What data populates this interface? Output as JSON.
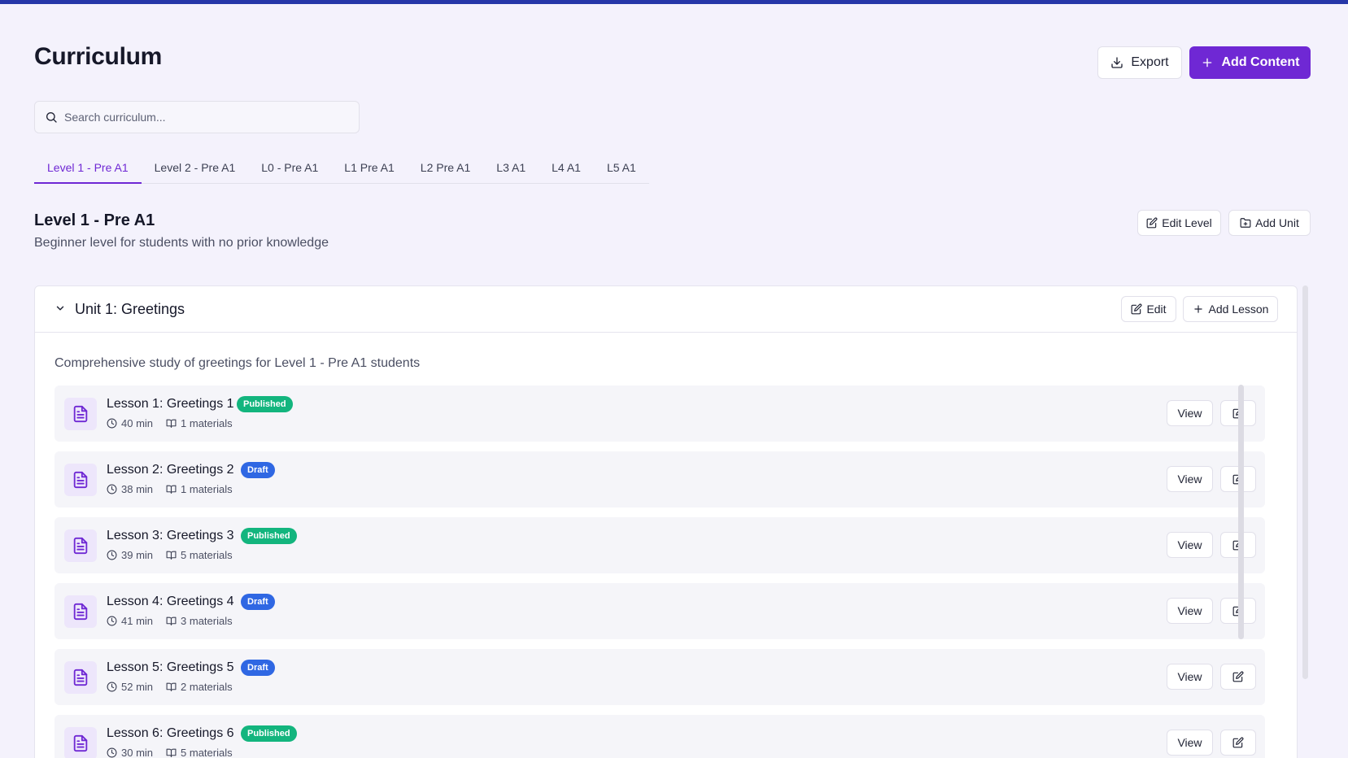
{
  "page": {
    "title": "Curriculum",
    "export_label": "Export",
    "add_content_label": "Add Content",
    "search_placeholder": "Search curriculum..."
  },
  "tabs": [
    {
      "label": "Level 1 - Pre A1",
      "active": true
    },
    {
      "label": "Level 2 - Pre A1",
      "active": false
    },
    {
      "label": "L0 - Pre A1",
      "active": false
    },
    {
      "label": "L1 Pre A1",
      "active": false
    },
    {
      "label": "L2 Pre A1",
      "active": false
    },
    {
      "label": "L3 A1",
      "active": false
    },
    {
      "label": "L4 A1",
      "active": false
    },
    {
      "label": "L5 A1",
      "active": false
    }
  ],
  "level": {
    "title": "Level 1 - Pre A1",
    "description": "Beginner level for students with no prior knowledge",
    "edit_level_label": "Edit Level",
    "add_unit_label": "Add Unit"
  },
  "unit": {
    "title": "Unit 1: Greetings",
    "edit_label": "Edit",
    "add_lesson_label": "Add Lesson",
    "description": "Comprehensive study of greetings for Level 1 - Pre A1 students"
  },
  "lessons": [
    {
      "title": "Lesson 1: Greetings 1",
      "status": "Published",
      "duration": "40 min",
      "materials": "1 materials",
      "view_label": "View"
    },
    {
      "title": "Lesson 2: Greetings 2",
      "status": "Draft",
      "duration": "38 min",
      "materials": "1 materials",
      "view_label": "View"
    },
    {
      "title": "Lesson 3: Greetings 3",
      "status": "Published",
      "duration": "39 min",
      "materials": "5 materials",
      "view_label": "View"
    },
    {
      "title": "Lesson 4: Greetings 4",
      "status": "Draft",
      "duration": "41 min",
      "materials": "3 materials",
      "view_label": "View"
    },
    {
      "title": "Lesson 5: Greetings 5",
      "status": "Draft",
      "duration": "52 min",
      "materials": "2 materials",
      "view_label": "View"
    },
    {
      "title": "Lesson 6: Greetings 6",
      "status": "Published",
      "duration": "30 min",
      "materials": "5 materials",
      "view_label": "View"
    }
  ],
  "colors": {
    "accent": "#6f28d4",
    "topbar": "#2637a8",
    "published": "#13b57e",
    "draft": "#2f67e3",
    "background": "#f4f2fc"
  },
  "icons": {
    "export": "download-icon",
    "add": "plus-icon",
    "search": "search-icon",
    "edit": "edit-icon",
    "add_unit": "folder-plus-icon",
    "collapse": "chevron-down-icon",
    "lesson": "document-icon",
    "duration": "clock-icon",
    "materials": "book-icon"
  }
}
